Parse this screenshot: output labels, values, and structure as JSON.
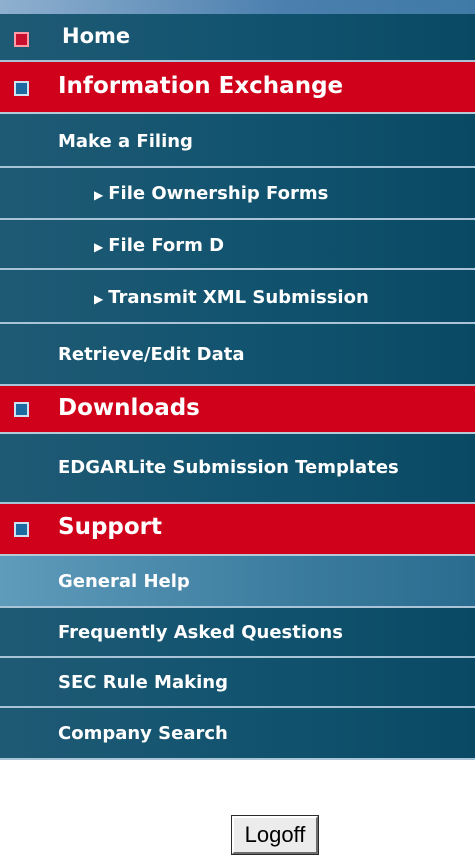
{
  "nav": {
    "home": "Home",
    "information_exchange": "Information Exchange",
    "make_a_filing": "Make a Filing",
    "file_ownership_forms": "File Ownership Forms",
    "file_form_d": "File Form D",
    "transmit_xml_submission": "Transmit XML Submission",
    "retrieve_edit_data": "Retrieve/Edit Data",
    "downloads": "Downloads",
    "edgarlite_templates": "EDGARLite Submission Templates",
    "support": "Support",
    "general_help": "General Help",
    "faq": "Frequently Asked Questions",
    "sec_rule_making": "SEC Rule Making",
    "company_search": "Company Search"
  },
  "logoff_label": "Logoff",
  "colors": {
    "section_red": "#d0021b",
    "nav_teal": "#11536f",
    "active_blue": "#3c7d9f"
  }
}
